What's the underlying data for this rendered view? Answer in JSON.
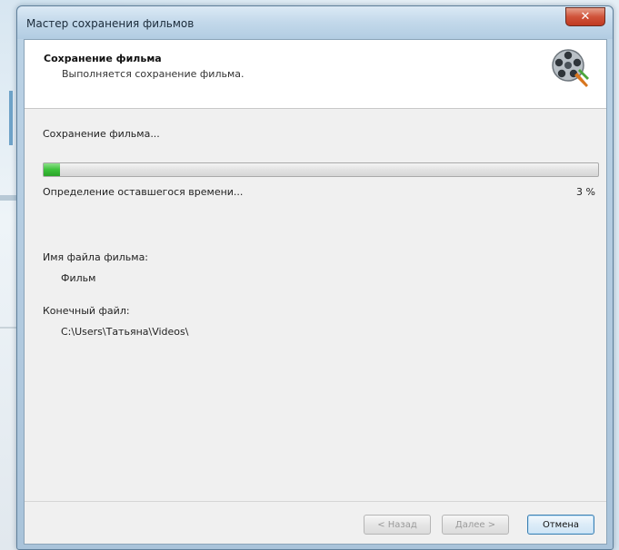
{
  "window": {
    "title": "Мастер сохранения фильмов",
    "close_symbol": "✕"
  },
  "header": {
    "title": "Сохранение фильма",
    "subtitle": "Выполняется сохранение фильма.",
    "icon": "film-reel-icon"
  },
  "progress": {
    "status": "Сохранение фильма...",
    "time_remaining": "Определение оставшегося времени...",
    "percent_label": "3 %",
    "percent_value": 3,
    "fill_color": "#3cc23a"
  },
  "details": {
    "filename_label": "Имя файла фильма:",
    "filename_value": "Фильм",
    "target_label": "Конечный файл:",
    "target_value": "C:\\Users\\Татьяна\\Videos\\"
  },
  "buttons": {
    "back": "< Назад",
    "next": "Далее >",
    "cancel": "Отмена"
  }
}
